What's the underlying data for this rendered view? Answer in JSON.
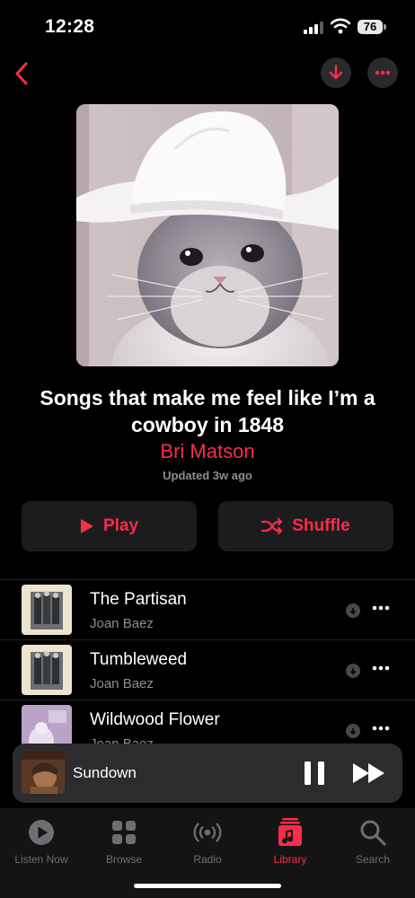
{
  "status": {
    "time": "12:28",
    "battery": "76"
  },
  "playlist": {
    "title": "Songs that make me feel like I’m a cowboy in 1848",
    "curator": "Bri Matson",
    "updated": "Updated 3w ago"
  },
  "actions": {
    "play_label": "Play",
    "shuffle_label": "Shuffle"
  },
  "tracks": [
    {
      "title": "The Partisan",
      "artist": "Joan Baez"
    },
    {
      "title": "Tumbleweed",
      "artist": "Joan Baez"
    },
    {
      "title": "Wildwood Flower",
      "artist": "Joan Baez"
    }
  ],
  "now_playing": {
    "title": "Sundown"
  },
  "tabs": [
    {
      "label": "Listen Now",
      "icon": "play-circle-icon"
    },
    {
      "label": "Browse",
      "icon": "grid-icon"
    },
    {
      "label": "Radio",
      "icon": "radio-waves-icon"
    },
    {
      "label": "Library",
      "icon": "music-library-icon",
      "active": true
    },
    {
      "label": "Search",
      "icon": "search-icon"
    }
  ],
  "colors": {
    "accent": "#fa2d48",
    "background": "#000000",
    "card": "#1c1c1e"
  }
}
